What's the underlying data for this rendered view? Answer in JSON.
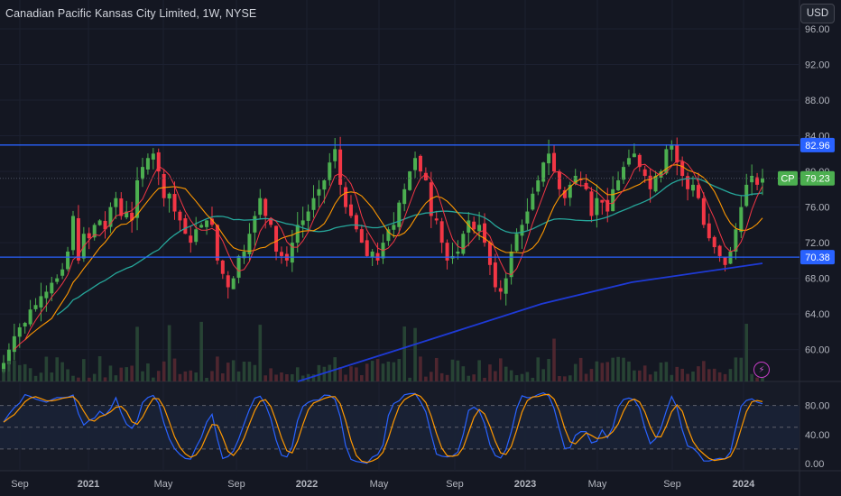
{
  "header": {
    "symbol_title": "Canadian Pacific Kansas City Limited, 1W, NYSE",
    "currency_button": "USD"
  },
  "price_scale": {
    "ticks": [
      "96.00",
      "92.00",
      "88.00",
      "84.00",
      "80.00",
      "76.00",
      "72.00",
      "68.00",
      "64.00",
      "60.00"
    ],
    "resistance_label": "82.96",
    "support_label": "70.38",
    "last_price_label": "79.23",
    "ticker_badge": "CP"
  },
  "oscillator_scale": {
    "ticks": [
      "80.00",
      "40.00",
      "0.00"
    ]
  },
  "time_axis": {
    "labels": [
      "Sep",
      "2021",
      "May",
      "Sep",
      "2022",
      "May",
      "Sep",
      "2023",
      "May",
      "Sep",
      "2024"
    ]
  },
  "colors": {
    "background": "#141722",
    "up": "#4caf50",
    "down": "#f23645",
    "hline": "#2962ff",
    "ma_fast": "#f23645",
    "ma_mid": "#ff9800",
    "ma_slow": "#26a69a",
    "ma_long": "#1e3ad6",
    "stoch_k": "#2962ff",
    "stoch_d": "#ff9800",
    "last_price": "#4caf50"
  },
  "icons": {
    "bolt": "lightning-icon"
  },
  "chart_data": {
    "type": "candlestick",
    "title": "Canadian Pacific Kansas City Limited, 1W, NYSE",
    "interval": "1W",
    "exchange": "NYSE",
    "currency": "USD",
    "ylim": [
      57,
      97
    ],
    "x_time_labels": [
      "Sep",
      "2021",
      "May",
      "Sep",
      "2022",
      "May",
      "Sep",
      "2023",
      "May",
      "Sep",
      "2024"
    ],
    "horizontal_lines": [
      {
        "value": 82.96,
        "color": "#2962ff"
      },
      {
        "value": 70.38,
        "color": "#2962ff"
      }
    ],
    "last_price": 79.23,
    "close_approx": [
      58.5,
      60.0,
      61.5,
      62.5,
      63.0,
      64.5,
      65.0,
      66.0,
      66.5,
      67.5,
      68.0,
      69.0,
      71.0,
      75.0,
      70.0,
      73.0,
      72.5,
      74.0,
      74.5,
      73.5,
      76.0,
      77.0,
      75.0,
      75.5,
      74.5,
      79.0,
      80.5,
      81.5,
      82.0,
      80.0,
      77.0,
      77.5,
      75.5,
      74.5,
      73.0,
      72.0,
      73.5,
      74.0,
      74.5,
      74.0,
      70.0,
      68.5,
      67.0,
      68.0,
      70.5,
      71.0,
      73.0,
      75.0,
      77.0,
      75.0,
      74.0,
      71.0,
      70.5,
      70.0,
      72.0,
      74.0,
      74.5,
      75.5,
      77.0,
      78.0,
      79.0,
      81.0,
      82.5,
      78.5,
      76.0,
      75.0,
      73.5,
      72.0,
      70.5,
      71.0,
      70.0,
      72.0,
      73.5,
      74.0,
      76.5,
      78.0,
      80.0,
      81.5,
      80.0,
      79.0,
      75.0,
      74.5,
      72.0,
      70.0,
      70.5,
      71.0,
      73.0,
      74.5,
      73.5,
      74.0,
      72.0,
      69.5,
      67.0,
      66.5,
      68.0,
      71.0,
      73.0,
      74.0,
      75.5,
      77.5,
      79.0,
      81.0,
      82.0,
      80.0,
      78.0,
      77.0,
      78.5,
      79.5,
      79.0,
      78.0,
      75.0,
      77.0,
      76.5,
      75.5,
      78.0,
      79.0,
      80.5,
      81.5,
      82.0,
      80.5,
      79.5,
      78.0,
      79.5,
      80.0,
      82.5,
      83.0,
      81.0,
      79.5,
      78.0,
      78.5,
      77.0,
      74.0,
      72.5,
      71.5,
      70.5,
      69.5,
      71.0,
      73.5,
      76.0,
      78.5,
      79.5,
      78.5,
      79.2
    ],
    "series": [
      {
        "name": "MA fast",
        "color": "#f23645"
      },
      {
        "name": "MA mid",
        "color": "#ff9800"
      },
      {
        "name": "MA slow",
        "color": "#26a69a"
      },
      {
        "name": "MA long",
        "color": "#1e3ad6"
      }
    ],
    "oscillator": {
      "type": "stochastic",
      "levels": [
        80,
        40,
        0
      ],
      "ylim": [
        -5,
        105
      ],
      "lines": [
        {
          "name": "%K",
          "color": "#2962ff"
        },
        {
          "name": "%D",
          "color": "#ff9800"
        }
      ]
    }
  }
}
